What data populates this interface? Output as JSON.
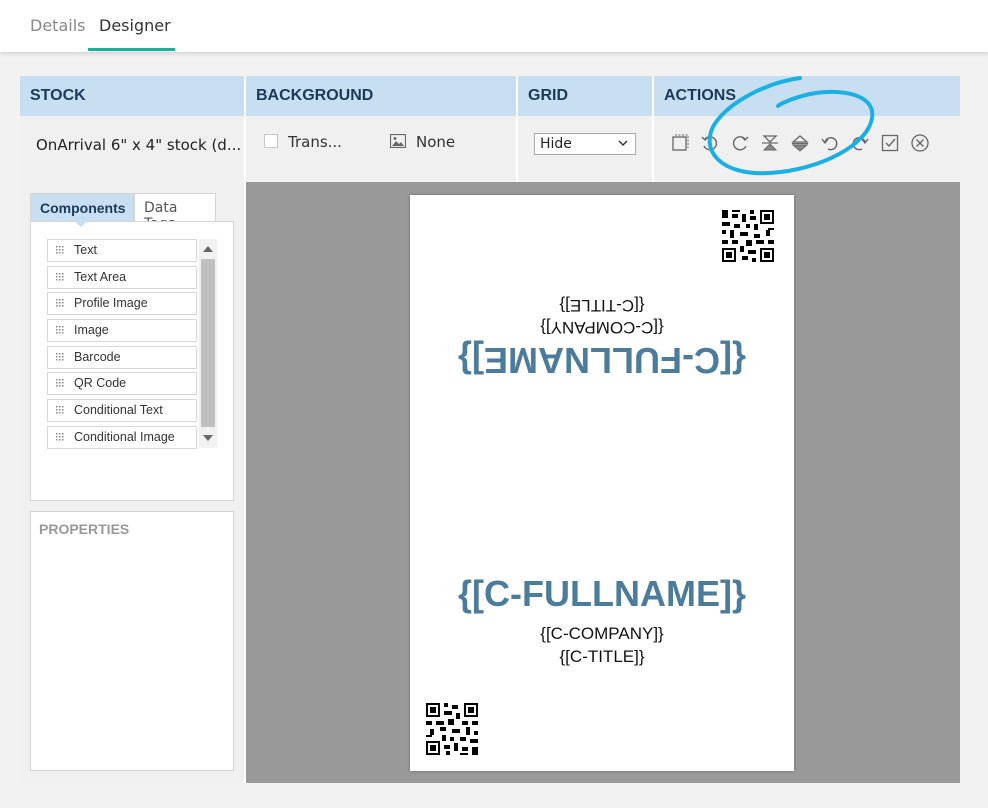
{
  "top_tabs": [
    "Details",
    "Designer"
  ],
  "active_top_tab": "Designer",
  "headers": {
    "stock": "STOCK",
    "background": "BACKGROUND",
    "grid": "GRID",
    "actions": "ACTIONS"
  },
  "stock": {
    "value": "OnArrival 6\" x 4\" stock (d..."
  },
  "background": {
    "transparent_label": "Trans...",
    "transparent_checked": false,
    "image_label": "None",
    "image_icon": "image-icon"
  },
  "grid": {
    "selected": "Hide"
  },
  "actions": {
    "icons": [
      "select-frame-icon",
      "rotate-left-icon",
      "rotate-right-icon",
      "flip-vertical-icon",
      "flip-horizontal-icon",
      "undo-icon",
      "redo-icon",
      "check-box-icon",
      "close-circle-icon"
    ]
  },
  "left": {
    "tabs": [
      "Components",
      "Data Tags"
    ],
    "active_tab": "Components",
    "components": [
      "Text",
      "Text Area",
      "Profile Image",
      "Image",
      "Barcode",
      "QR Code",
      "Conditional Text",
      "Conditional Image"
    ],
    "properties_title": "PROPERTIES"
  },
  "badge": {
    "top_flipped": {
      "fullname": "{[C-FULLNAME]}",
      "company": "{[C-COMPANY]}",
      "title": "{[C-TITLE]}"
    },
    "bottom": {
      "fullname": "{[C-FULLNAME]}",
      "company": "{[C-COMPANY]}",
      "title": "{[C-TITLE]}"
    }
  },
  "colors": {
    "accent_tab": "#16b39a",
    "header_bg": "#c8dff2",
    "header_text": "#1b3a57",
    "name_text": "#4b7c9b",
    "annotation": "#1ab0e4",
    "canvas_bg": "#999999"
  }
}
